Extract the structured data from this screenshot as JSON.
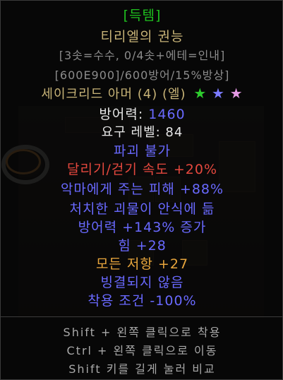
{
  "tooltip": {
    "quality_tag": "[득템]",
    "item_name": "티리엘의 권능",
    "socket_info": "[3솟=수수, 0/4솟+에테=인내]",
    "base_stats": "[600E900]/600방어/15%방상]",
    "base_type": "세이크리드 아머 (4) (엘)",
    "stars": [
      {
        "glyph": "★",
        "color": "#2ecc2e"
      },
      {
        "glyph": "★",
        "color": "#7b7bff"
      },
      {
        "glyph": "★",
        "color": "#e59ae5"
      }
    ],
    "defense_label": "방어력:",
    "defense_value": "1460",
    "required_level": "요구 레벨: 84",
    "mods": [
      {
        "text": "파괴 불가",
        "color": "blue"
      },
      {
        "text": "달리기/걷기 속도 +20%",
        "color": "red"
      },
      {
        "text": "악마에게 주는 피해 +88%",
        "color": "blue"
      },
      {
        "text": "처치한 괴물이 안식에 듦",
        "color": "blue"
      },
      {
        "text": "방어력 +143% 증가",
        "color": "blue"
      },
      {
        "text": "힘 +28",
        "color": "blue"
      },
      {
        "text": "모든 저항 +27",
        "color": "orange"
      },
      {
        "text": "빙결되지 않음",
        "color": "blue"
      },
      {
        "text": "착용 조건 -100%",
        "color": "blue"
      }
    ],
    "hints": [
      "Shift + 왼쪽 클릭으로 착용",
      "Ctrl + 왼쪽 클릭으로 이동",
      "Shift 키를 길게 눌러 비교"
    ]
  },
  "colors": {
    "quality": "#1fc21f",
    "gold": "#c7b377",
    "magic_blue": "#6969ff",
    "red": "#e5483e",
    "orange": "#e8a53c"
  }
}
